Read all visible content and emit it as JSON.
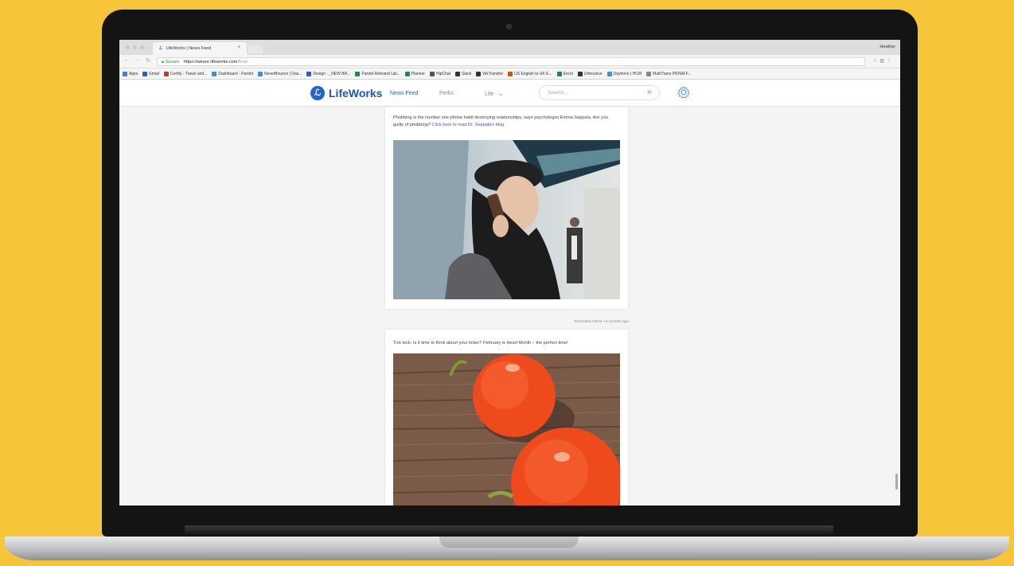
{
  "browser": {
    "tab_title": "LifeWorks | News Feed",
    "tab_close": "×",
    "profile_name": "Heather",
    "secure_label": "Secure",
    "url_host": "https://weare.lifeworks.com",
    "url_path": "/feed",
    "bookmarks": [
      {
        "label": "Apps",
        "color": "#4a7bd0"
      },
      {
        "label": "Email",
        "color": "#2e5fbf"
      },
      {
        "label": "Certify - Travel and...",
        "color": "#c0392b"
      },
      {
        "label": "Dashboard - Pardot",
        "color": "#3b8fd9"
      },
      {
        "label": "NeverBounce | Das...",
        "color": "#3b8fd9"
      },
      {
        "label": "Design - _NEW BR...",
        "color": "#2e5fbf"
      },
      {
        "label": "Pardot Rebrand Upl...",
        "color": "#1e8e3e"
      },
      {
        "label": "Planner",
        "color": "#1e8e3e"
      },
      {
        "label": "HipChat",
        "color": "#555555"
      },
      {
        "label": "Slack",
        "color": "#333333"
      },
      {
        "label": "WeTransfer",
        "color": "#333333"
      },
      {
        "label": "US English to UK E...",
        "color": "#d35400"
      },
      {
        "label": "Excel",
        "color": "#1e8e3e"
      },
      {
        "label": "Unbounce",
        "color": "#333333"
      },
      {
        "label": "Dayforce | HCM",
        "color": "#3b8fd9"
      },
      {
        "label": "MultiTrans PRISM F...",
        "color": "#888888"
      }
    ]
  },
  "site": {
    "brand": "LifeWorks",
    "nav": {
      "news_feed": "News Feed",
      "perks": "Perks",
      "life": "Life"
    },
    "search_placeholder": "Search..."
  },
  "feed": {
    "post1": {
      "text": "Phubbing is the number one phone habit destroying relationships, says psychologist Emma Seppala. Are you guilty of phubbing?",
      "link": "Click here to read Dr. Seppälä's blog"
    },
    "post2": {
      "meta": "Promoted Article • 4 months ago",
      "text": "Tick tock: Is it time to think about your ticker? February is Heart Month – the perfect time!"
    }
  },
  "colors": {
    "background": "#f6c53a",
    "brand_blue": "#2465c8"
  }
}
